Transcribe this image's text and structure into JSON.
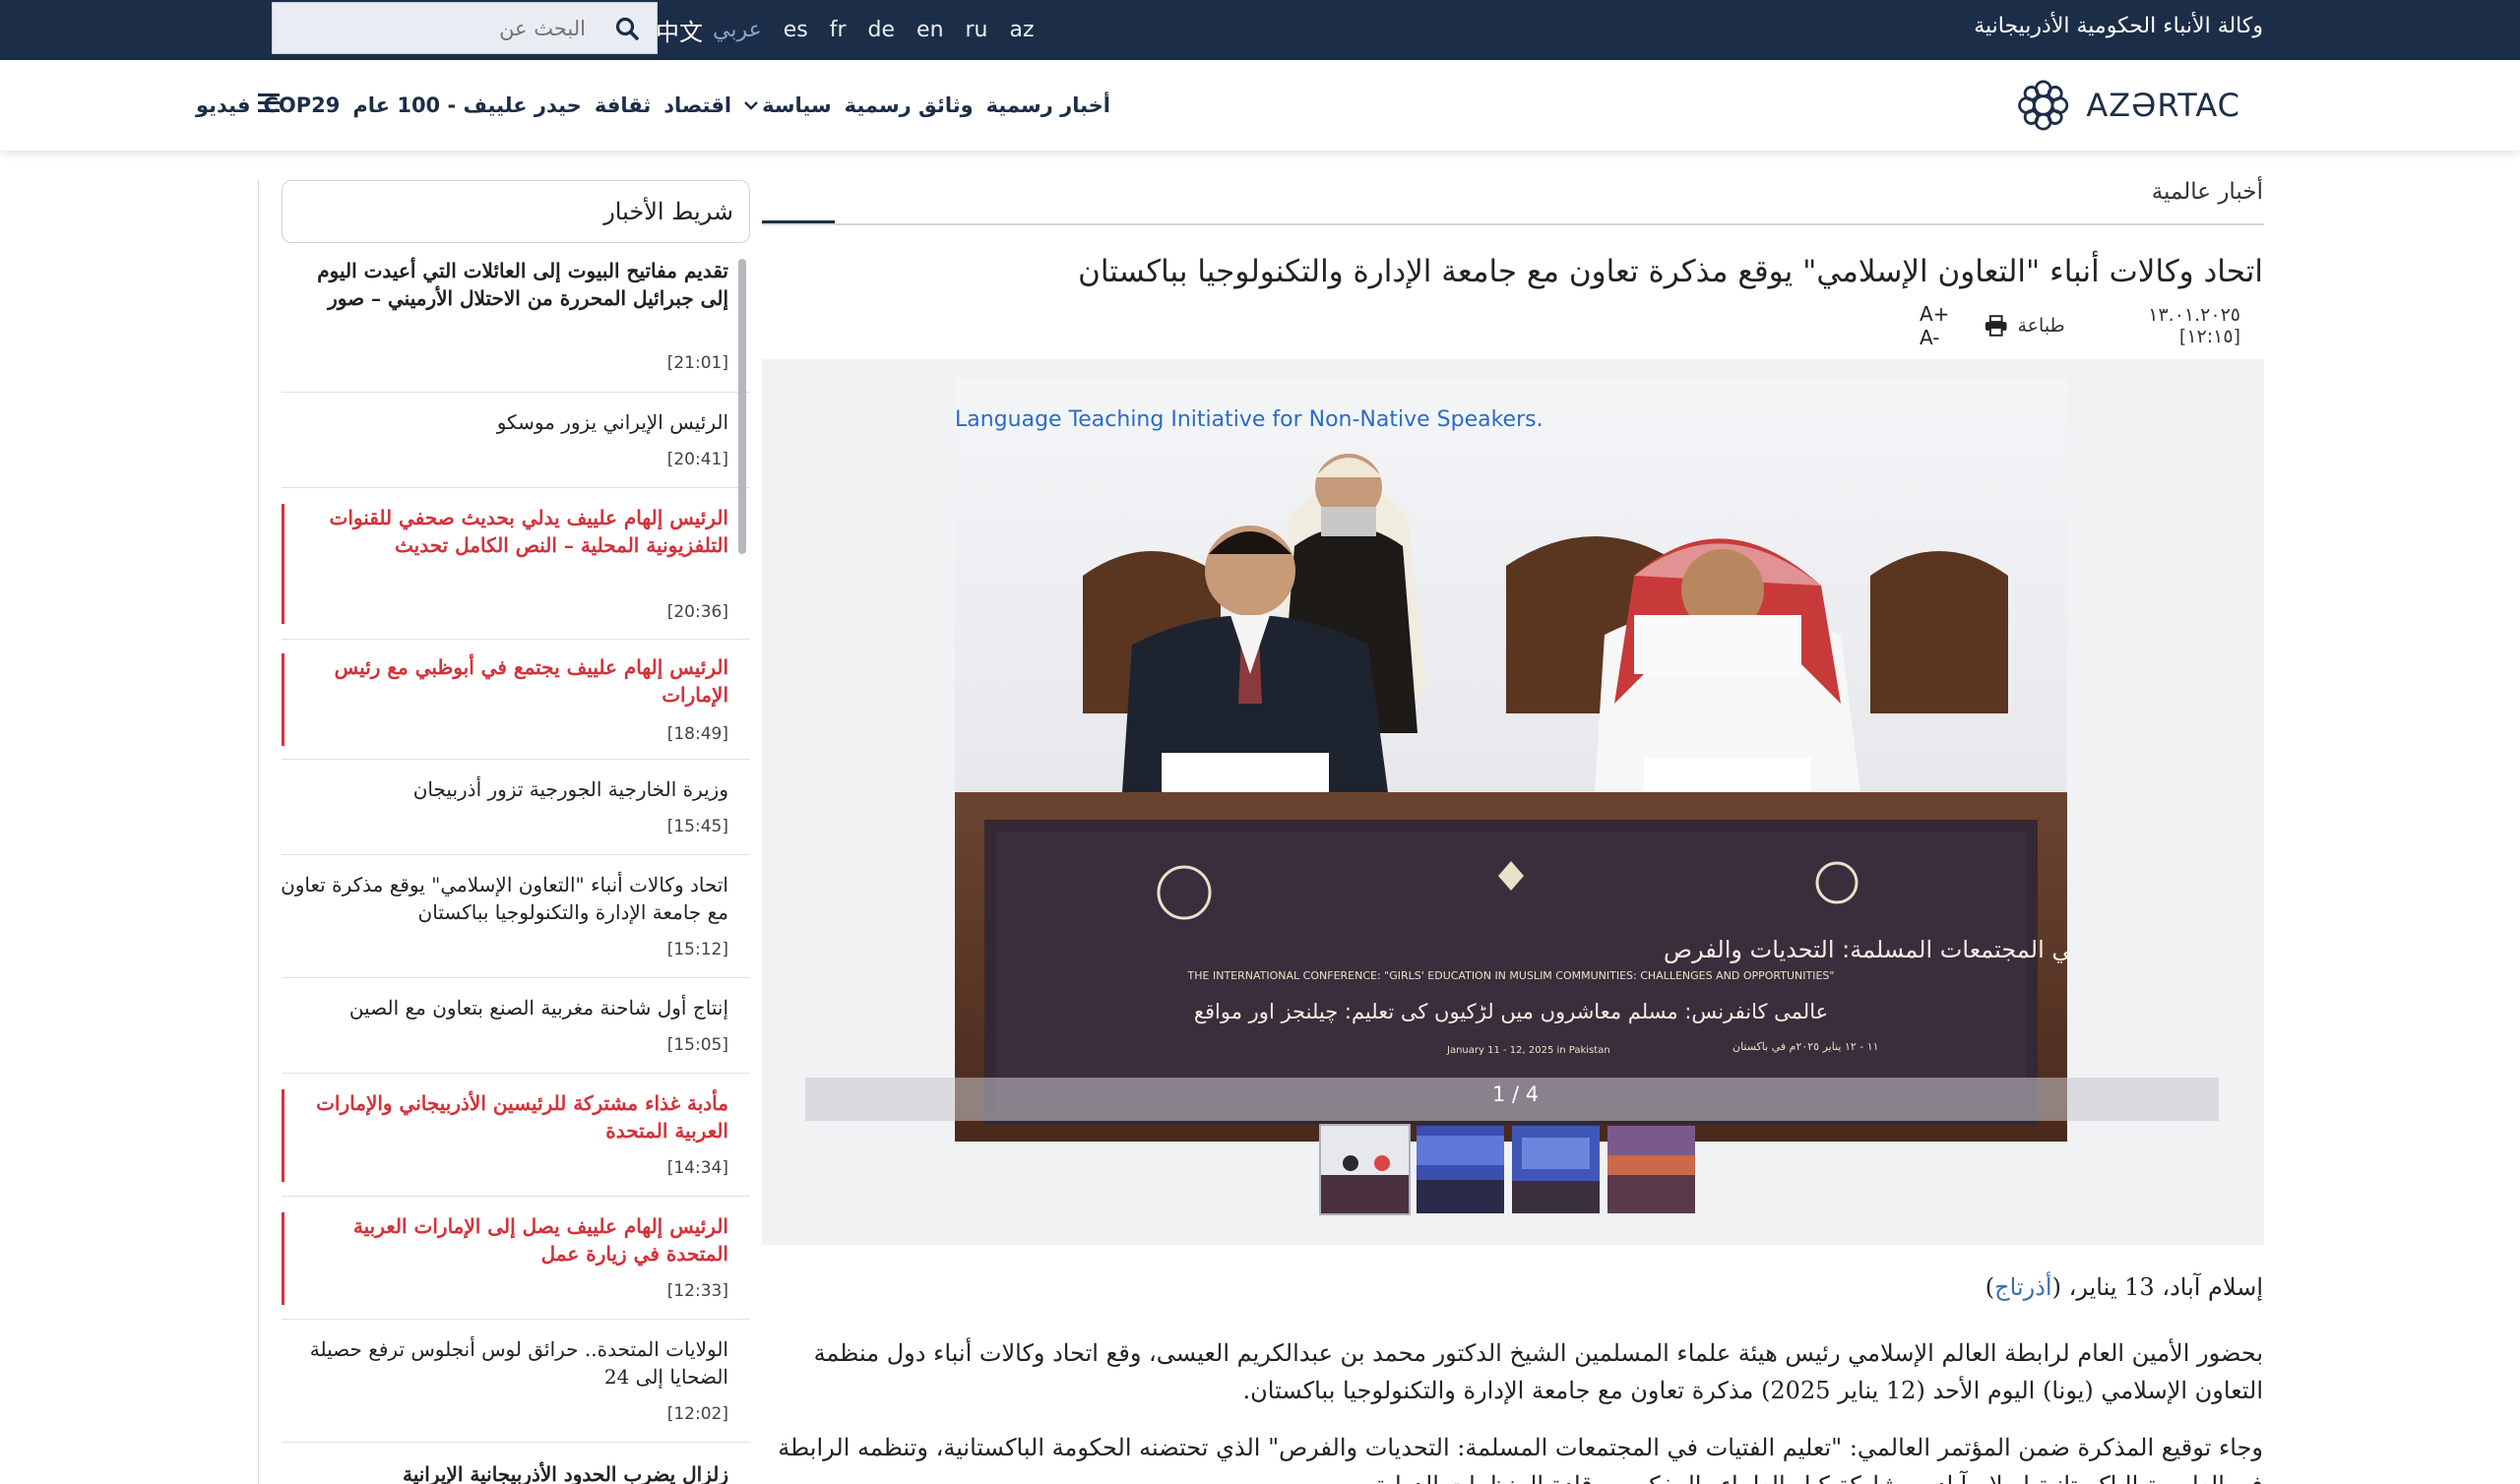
{
  "topbar": {
    "agency_title": "وكالة الأنباء الحكومية الأذربيجانية",
    "languages": [
      {
        "label": "中文",
        "active": false
      },
      {
        "label": "عربي",
        "active": true
      },
      {
        "label": "es",
        "active": false
      },
      {
        "label": "fr",
        "active": false
      },
      {
        "label": "de",
        "active": false
      },
      {
        "label": "en",
        "active": false
      },
      {
        "label": "ru",
        "active": false
      },
      {
        "label": "az",
        "active": false
      }
    ],
    "search": {
      "placeholder": "البحث عن",
      "icon": "search-icon"
    }
  },
  "navbar": {
    "logo_text": "AZƏRTAC",
    "items": [
      {
        "label": "أخبار رسمية"
      },
      {
        "label": "وثائق رسمية"
      },
      {
        "label": "سياسة",
        "has_dropdown": true
      },
      {
        "label": "اقتصاد"
      },
      {
        "label": "ثقافة"
      },
      {
        "label": "حيدر علييف - 100 عام"
      },
      {
        "label": "COP29"
      },
      {
        "label": "فيديو"
      }
    ],
    "menu_icon": "hamburger-menu-icon"
  },
  "sidebar": {
    "header": "شريط الأخبار",
    "items": [
      {
        "title": "تقديم مفاتيح البيوت إلى العائلات التي أعيدت اليوم إلى جبرائيل المحررة من الاحتلال الأرميني – صور",
        "time": "[21:01]",
        "style": "bold"
      },
      {
        "title": "الرئيس الإيراني يزور موسكو",
        "time": "[20:41]",
        "style": "normal"
      },
      {
        "title": "الرئيس إلهام علييف يدلي بحديث صحفي للقنوات التلفزيونية المحلية – النص الكامل تحديث",
        "time": "[20:36]",
        "style": "red"
      },
      {
        "title": "الرئيس إلهام علييف يجتمع في أبوظبي مع رئيس الإمارات",
        "time": "[18:49]",
        "style": "red"
      },
      {
        "title": "وزيرة الخارجية الجورجية تزور أذربيجان",
        "time": "[15:45]",
        "style": "normal"
      },
      {
        "title": "اتحاد وكالات أنباء \"التعاون الإسلامي\" يوقع مذكرة تعاون مع جامعة الإدارة والتكنولوجيا بباكستان",
        "time": "[15:12]",
        "style": "normal"
      },
      {
        "title": "إنتاج أول شاحنة مغربية الصنع بتعاون مع الصين",
        "time": "[15:05]",
        "style": "normal"
      },
      {
        "title": "مأدبة غذاء مشتركة للرئيسين الأذربيجاني والإمارات العربية المتحدة",
        "time": "[14:34]",
        "style": "red"
      },
      {
        "title": "الرئيس إلهام علييف يصل إلى الإمارات العربية المتحدة في زيارة عمل",
        "time": "[12:33]",
        "style": "red"
      },
      {
        "title": "الولايات المتحدة.. حرائق لوس أنجلوس ترفع حصيلة الضحايا إلى 24",
        "time": "[12:02]",
        "style": "normal"
      },
      {
        "title": "زلزال يضرب الحدود الأذربيجانية الإيرانية",
        "time": "",
        "style": "bold"
      }
    ]
  },
  "article": {
    "breadcrumb": "أخبار عالمية",
    "headline": "اتحاد وكالات أنباء \"التعاون الإسلامي\" يوقع مذكرة تعاون مع جامعة الإدارة والتكنولوجيا بباكستان",
    "date": "١٣.٠١.٢٠٢٥ [١٢:١٥]",
    "print_label": "طباعة",
    "font_controls": "A+ A-",
    "gallery": {
      "counter": "1 / 4",
      "banner_top_text": "Language Teaching Initiative for Non-Native Speakers.",
      "banner_arabic": "المؤتمر العالمي: تعليم الفتيات في المجتمعات المسلمة: التحديات والفرص",
      "banner_english": "THE INTERNATIONAL CONFERENCE: \"GIRLS' EDUCATION IN MUSLIM COMMUNITIES: CHALLENGES AND OPPORTUNITIES\"",
      "banner_urdu": "عالمی کانفرنس: مسلم معاشروں میں لڑکیوں کی تعلیم: چیلنجز اور مواقع",
      "banner_date_en": "January 11 - 12, 2025 in Pakistan",
      "banner_date_ar": "١١ - ١٢ يناير ٢٠٢٥م في باكستان",
      "thumbnails": 4
    },
    "dateline_prefix": "إسلام آباد، 13 يناير، (",
    "dateline_source": "أذرتاج",
    "dateline_suffix": ")",
    "paragraph_1": "بحضور الأمين العام لرابطة العالم الإسلامي رئيس هيئة علماء المسلمين الشيخ الدكتور محمد بن عبدالكريم العيسى، وقع اتحاد وكالات أنباء دول منظمة التعاون الإسلامي (يونا) اليوم الأحد (12 يناير 2025) مذكرة تعاون مع جامعة الإدارة والتكنولوجيا بباكستان.",
    "paragraph_2": "وجاء توقيع المذكرة ضمن المؤتمر العالمي: \"تعليم الفتيات في المجتمعات المسلمة: التحديات والفرص\" الذي تحتضنه الحكومة الباكستانية، وتنظمه الرابطة في العاصمة الباكستانية إسلام آباد، بمشاركة كبار العلماء والمفكرين وقادة المنظمات الدولية."
  },
  "colors": {
    "topbar_bg": "#1c2e47",
    "accent_red": "#d3323a",
    "link_blue": "#3b6fb0"
  }
}
